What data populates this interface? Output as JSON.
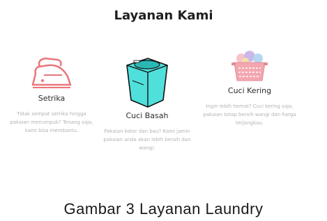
{
  "section": {
    "title": "Layanan Kami"
  },
  "services": [
    {
      "name": "Setrika",
      "icon": "iron-icon",
      "description": "Tidak sempat setrika hingga pakaian menumpuk? Tenang saja, kami bisa membantu."
    },
    {
      "name": "Cuci Basah",
      "icon": "washing-machine-icon",
      "description": "Pakaian kotor dan bau? Kami jamin pakaian anda akan lebih bersih dan wangi."
    },
    {
      "name": "Cuci Kering",
      "icon": "laundry-basket-icon",
      "description": "Ingin lebih hemat? Cuci kering saja, pakaian tetap bersih wangi dan harga terjangkau."
    }
  ],
  "caption": "Gambar 3 Layanan Laundry",
  "colors": {
    "iron": "#e8767a",
    "washer": "#4fe0dc",
    "basket": "#f3a7b0"
  }
}
